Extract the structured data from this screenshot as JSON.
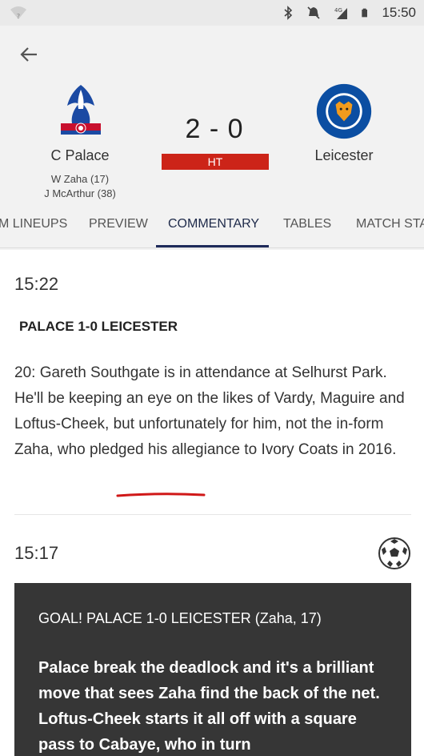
{
  "status_bar": {
    "network": "4G",
    "time": "15:50"
  },
  "header": {
    "back_icon": "arrow-left-icon",
    "home": {
      "name": "C Palace",
      "crest_icon": "crystal-palace-crest",
      "scorers": [
        "W Zaha (17)",
        "J McArthur (38)"
      ]
    },
    "away": {
      "name": "Leicester",
      "crest_icon": "leicester-city-crest"
    },
    "score": "2 - 0",
    "status": "HT",
    "status_color": "#cc2418"
  },
  "tabs": [
    {
      "label": "M LINEUPS"
    },
    {
      "label": "PREVIEW"
    },
    {
      "label": "COMMENTARY",
      "active": true
    },
    {
      "label": "TABLES"
    },
    {
      "label": "MATCH STA"
    }
  ],
  "feed": {
    "entry1": {
      "time": "15:22",
      "headline": "PALACE 1-0 LEICESTER",
      "text_before": "20: Gareth Southgate is in attendance at Selhurst Park. He'll be keeping an eye on the likes of Vardy, Maguire and Loftus-Cheek, but unfortunately for him, not the in-form Zaha, who pledged his allegiance to ",
      "text_highlight": "Ivory Coats",
      "text_after": " in 2016."
    },
    "entry2": {
      "time": "15:17",
      "icon": "football-icon",
      "title": "GOAL! PALACE 1-0 LEICESTER (Zaha, 17)",
      "text": "Palace break the deadlock and it's a brilliant move that sees Zaha find the back of the net. Loftus-Cheek starts it all off with a square pass to Cabaye, who in turn"
    }
  },
  "colors": {
    "accent": "#1e2a5a",
    "goal_box": "#363636",
    "annotation_underline": "#d01818"
  }
}
